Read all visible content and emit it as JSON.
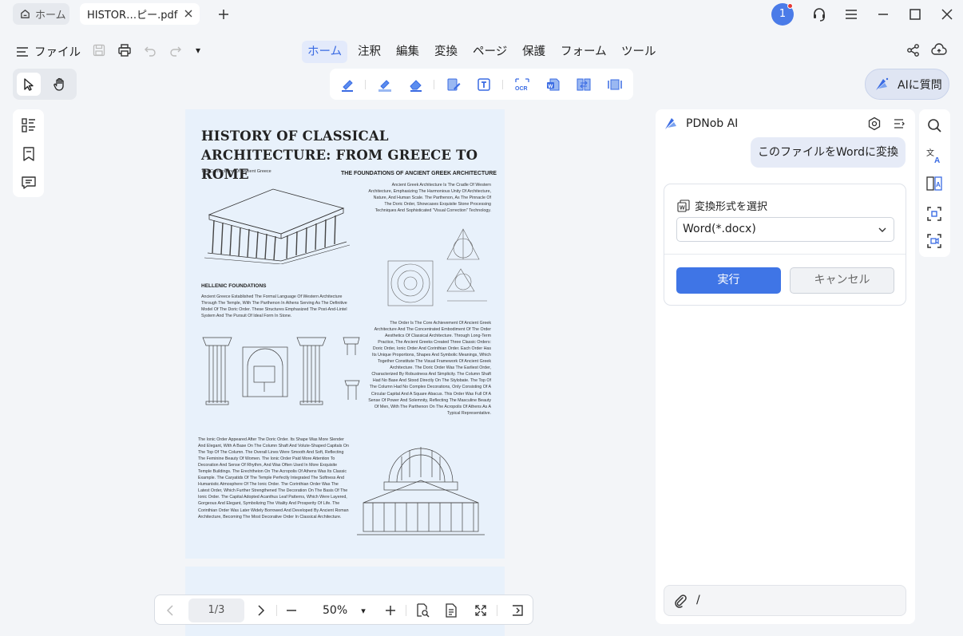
{
  "tabs": {
    "home_label": "ホーム",
    "doc_label": "HISTOR…ピー.pdf"
  },
  "titlebar": {
    "notification_count": "1"
  },
  "menu": {
    "file_label": "ファイル",
    "items": [
      "ホーム",
      "注釈",
      "編集",
      "変換",
      "ページ",
      "保護",
      "フォーム",
      "ツール"
    ],
    "zoom_dropdown": "▾"
  },
  "toolbar": {
    "ai_button_label": "AIに質問"
  },
  "document": {
    "title": "HISTORY OF CLASSICAL  ARCHITECTURE: FROM GREECE TO ROME",
    "subtitle": "The Cornerstone Of Ancient Greece",
    "section1_heading": "THE FOUNDATIONS OF ANCIENT GREEK ARCHITECTURE",
    "section1_text": "Ancient Greek Architecture Is The Cradle Of Western Architecture, Emphasizing The Harmonious Unity Of Architecture, Nature, And Human Scale. The Parthenon, As The Pinnacle Of The Doric Order, Showcases Exquisite Stone Processing Techniques And Sophisticated \"Visual Correction\" Technology.",
    "section2_heading": "HELLENIC FOUNDATIONS",
    "section2_text": "Ancient Greece Established The Formal Language Of Western Architecture Through The Temple, With The Parthenon In Athens Serving As The Definitive Model Of The Doric Order. These Structures Emphasized The Post-And-Lintel System And The Pursuit Of Ideal Form In Stone.",
    "section3_text": "The Order Is The Core Achievement Of Ancient Greek Architecture And The Concentrated Embodiment Of The Order Aesthetics Of Classical Architecture. Through Long-Term Practice, The Ancient Greeks Created Three Classic Orders: Doric Order, Ionic Order And Corinthian Order. Each Order Has Its Unique Proportions, Shapes And Symbolic Meanings, Which Together Constitute The Visual Framework Of Ancient Greek Architecture. The Doric Order Was The Earliest Order, Characterized By Robustness And Simplicity. The Column Shaft Had No Base And Stood Directly On The Stylobate. The Top Of The Column Had No Complex Decorations, Only Consisting Of A Circular Capital And A Square Abacus. This Order Was Full Of A Sense Of Power And Solemnity, Reflecting The Masculine Beauty Of Men, With The Parthenon On The Acropolis Of Athens As A Typical Representative.",
    "section4_text": "The Ionic Order Appeared After The Doric Order. Its Shape Was More Slender And Elegant, With A Base On The Column Shaft And Volute-Shaped Capitals On The Top Of The Column. The Overall Lines Were Smooth And Soft, Reflecting The Feminine Beauty Of Women. The Ionic Order Paid More Attention To Decoration And Sense Of Rhythm, And Was Often Used In More Exquisite Temple Buildings. The Erechtheion On The Acropolis Of Athens Was Its Classic Example. The Caryatids Of The Temple Perfectly Integrated The Softness And Humanistic Atmosphere Of The Ionic Order. The Corinthian Order Was The Latest Order, Which Further Strengthened The Decoration On The Basis Of The Ionic Order. The Capital Adopted Acanthus Leaf Patterns, Which Were Layered, Gorgeous And Elegant, Symbolizing The Vitality And Prosperity Of Life. The Corinthian Order Was Later Widely Borrowed And Developed By Ancient Roman Architecture, Becoming The Most Decorative Order In Classical Architecture."
  },
  "navigation": {
    "page_indicator": "1/3",
    "zoom": "50%"
  },
  "ai_panel": {
    "title": "PDNob AI",
    "user_message": "このファイルをWordに変換",
    "format_label": "変換形式を選択",
    "format_value": "Word(*.docx)",
    "run_label": "実行",
    "cancel_label": "キャンセル",
    "input_value": "/"
  },
  "colors": {
    "accent": "#3f75e6",
    "page_bg": "#e8f1fb",
    "notification": "#e53935"
  }
}
